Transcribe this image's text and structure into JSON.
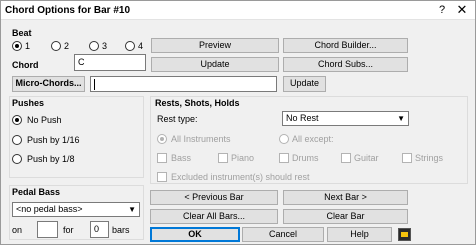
{
  "window": {
    "title": "Chord Options for Bar #10",
    "help_glyph": "?",
    "close_glyph": "✕"
  },
  "beat": {
    "heading": "Beat",
    "options": [
      "1",
      "2",
      "3",
      "4"
    ],
    "selected": "1"
  },
  "chord": {
    "label": "Chord",
    "value": "C"
  },
  "micro_chords": {
    "button": "Micro-Chords...",
    "value": "",
    "update": "Update"
  },
  "buttons": {
    "preview": "Preview",
    "update": "Update",
    "chord_builder": "Chord Builder...",
    "chord_subs": "Chord Subs...",
    "prev_bar": "< Previous Bar",
    "next_bar": "Next Bar >",
    "clear_all_bars": "Clear All Bars...",
    "clear_bar": "Clear Bar",
    "ok": "OK",
    "cancel": "Cancel",
    "help": "Help"
  },
  "pushes": {
    "heading": "Pushes",
    "options": [
      "No Push",
      "Push by 1/16",
      "Push by 1/8"
    ],
    "selected": "No Push"
  },
  "rests": {
    "heading": "Rests, Shots, Holds",
    "type_label": "Rest type:",
    "type_value": "No Rest",
    "all_instruments": "All Instruments",
    "all_except": "All except:",
    "instruments": [
      "Bass",
      "Piano",
      "Drums",
      "Guitar",
      "Strings"
    ],
    "excluded_label": "Excluded instrument(s) should rest"
  },
  "pedal_bass": {
    "heading": "Pedal Bass",
    "select_value": "<no pedal bass>",
    "on_label": "on",
    "on_value": "",
    "for_label": "for",
    "for_value": "0",
    "bars_label": "bars"
  }
}
